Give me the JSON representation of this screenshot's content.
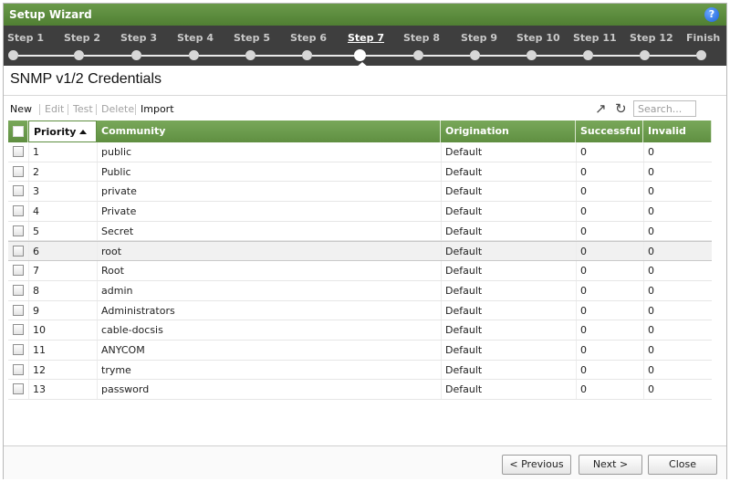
{
  "window": {
    "title": "Setup Wizard",
    "help_icon": "?"
  },
  "steps": {
    "labels": [
      "Step 1",
      "Step 2",
      "Step 3",
      "Step 4",
      "Step 5",
      "Step 6",
      "Step 7",
      "Step 8",
      "Step 9",
      "Step 10",
      "Step 11",
      "Step 12",
      "Finish"
    ],
    "current_index": 6
  },
  "page": {
    "title": "SNMP v1/2 Credentials"
  },
  "toolbar": {
    "new": "New",
    "edit": "Edit",
    "test": "Test",
    "delete": "Delete",
    "import": "Import",
    "search_placeholder": "Search..."
  },
  "table": {
    "headers": {
      "priority": "Priority",
      "community": "Community",
      "origination": "Origination",
      "successful": "Successful",
      "invalid": "Invalid"
    },
    "sort_column": "priority",
    "rows": [
      {
        "priority": "1",
        "community": "public",
        "origination": "Default",
        "successful": "0",
        "invalid": "0"
      },
      {
        "priority": "2",
        "community": "Public",
        "origination": "Default",
        "successful": "0",
        "invalid": "0"
      },
      {
        "priority": "3",
        "community": "private",
        "origination": "Default",
        "successful": "0",
        "invalid": "0"
      },
      {
        "priority": "4",
        "community": "Private",
        "origination": "Default",
        "successful": "0",
        "invalid": "0"
      },
      {
        "priority": "5",
        "community": "Secret",
        "origination": "Default",
        "successful": "0",
        "invalid": "0"
      },
      {
        "priority": "6",
        "community": "root",
        "origination": "Default",
        "successful": "0",
        "invalid": "0"
      },
      {
        "priority": "7",
        "community": "Root",
        "origination": "Default",
        "successful": "0",
        "invalid": "0"
      },
      {
        "priority": "8",
        "community": "admin",
        "origination": "Default",
        "successful": "0",
        "invalid": "0"
      },
      {
        "priority": "9",
        "community": "Administrators",
        "origination": "Default",
        "successful": "0",
        "invalid": "0"
      },
      {
        "priority": "10",
        "community": "cable-docsis",
        "origination": "Default",
        "successful": "0",
        "invalid": "0"
      },
      {
        "priority": "11",
        "community": "ANYCOM",
        "origination": "Default",
        "successful": "0",
        "invalid": "0"
      },
      {
        "priority": "12",
        "community": "tryme",
        "origination": "Default",
        "successful": "0",
        "invalid": "0"
      },
      {
        "priority": "13",
        "community": "password",
        "origination": "Default",
        "successful": "0",
        "invalid": "0"
      }
    ],
    "highlighted_row": 5
  },
  "footer": {
    "previous": "< Previous",
    "next": "Next >",
    "close": "Close"
  },
  "colors": {
    "header_green": "#5f8f41",
    "steps_bg": "#3e3e3e",
    "help_blue": "#1b5fd6"
  }
}
